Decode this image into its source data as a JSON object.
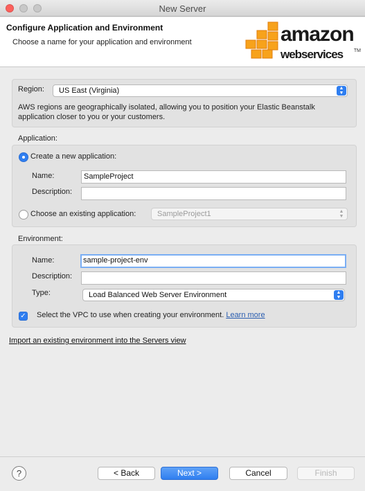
{
  "window": {
    "title": "New Server",
    "accent": "#2f7ef0"
  },
  "header": {
    "title": "Configure Application and Environment",
    "subtitle": "Choose a name for your application and environment",
    "logo_line1": "amazon",
    "logo_line2": "webservices",
    "logo_tm": "TM"
  },
  "region": {
    "label": "Region:",
    "value": "US East (Virginia)",
    "description": "AWS regions are geographically isolated, allowing you to position your Elastic Beanstalk application closer to you or your customers."
  },
  "application": {
    "section_label": "Application:",
    "create_new_label": "Create a new application:",
    "create_new_selected": true,
    "name_label": "Name:",
    "name_value": "SampleProject",
    "description_label": "Description:",
    "description_value": "",
    "existing_label": "Choose an existing application:",
    "existing_value": "SampleProject1"
  },
  "environment": {
    "section_label": "Environment:",
    "name_label": "Name:",
    "name_value": "sample-project-env",
    "description_label": "Description:",
    "description_value": "",
    "type_label": "Type:",
    "type_value": "Load Balanced Web Server Environment",
    "vpc_checked": true,
    "vpc_text": "Select the VPC to use when creating your environment.",
    "vpc_link": "Learn more"
  },
  "import_link": "Import an existing environment into the Servers view",
  "footer": {
    "help_label": "?",
    "back_label": "< Back",
    "next_label": "Next >",
    "cancel_label": "Cancel",
    "finish_label": "Finish"
  }
}
